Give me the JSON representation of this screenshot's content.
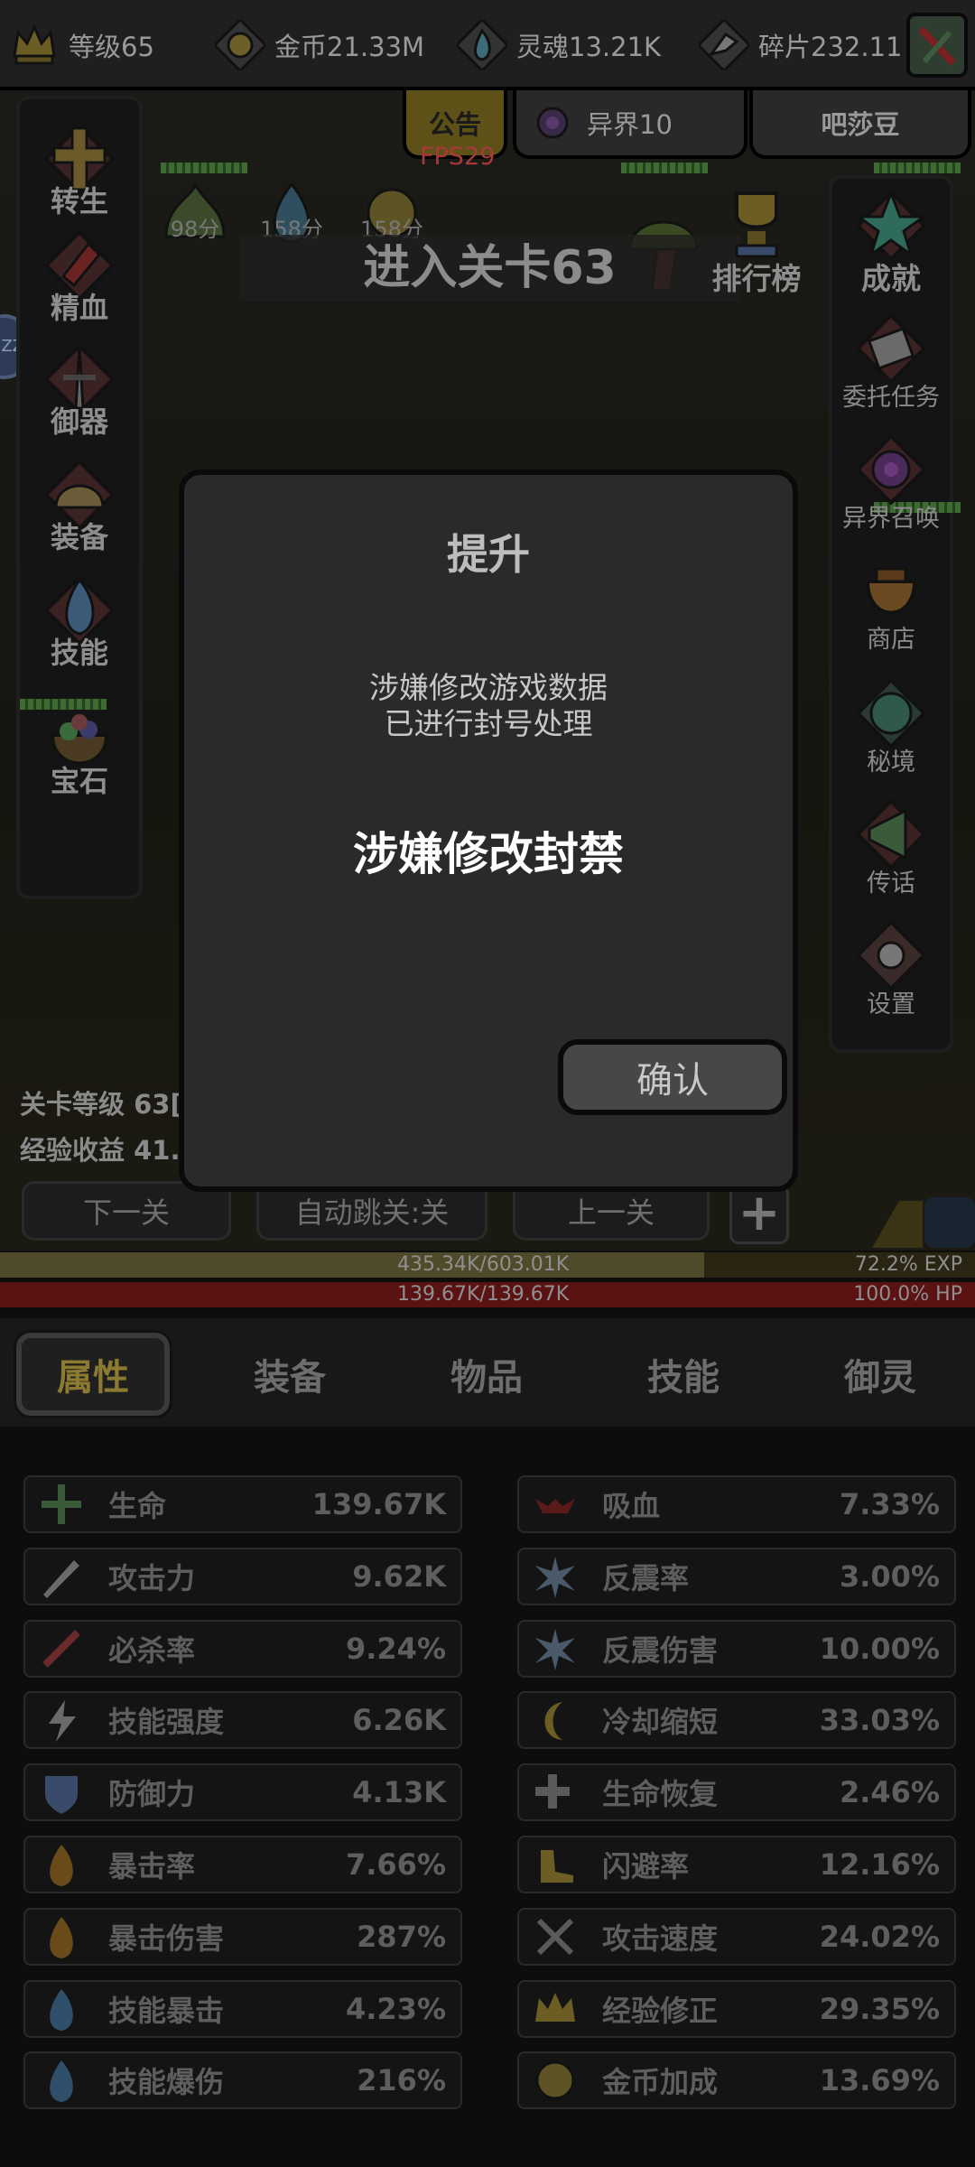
{
  "colors": {
    "accent_gold": "#8b7a30",
    "fps_red": "#a83a3a",
    "hp_red": "#5a1212",
    "exp_gold": "#4f4a2a"
  },
  "top_bar": {
    "resources": [
      {
        "icon": "crown-icon",
        "label": "等级65"
      },
      {
        "icon": "gold-coin-icon",
        "label": "金币21.33M"
      },
      {
        "icon": "soul-flame-icon",
        "label": "灵魂13.21K"
      },
      {
        "icon": "fragment-icon",
        "label": "碎片232.11"
      }
    ]
  },
  "header_tabs": {
    "notice": "公告",
    "otherworld": "异界10",
    "player": "吧莎豆"
  },
  "fps": "FPS29",
  "left_menu": [
    "转生",
    "精血",
    "御器",
    "装备",
    "技能",
    "宝石"
  ],
  "right_menu": [
    "排行榜",
    "成就",
    "委托任务",
    "异界召唤",
    "商店",
    "秘境",
    "传话",
    "设置"
  ],
  "monsters": [
    {
      "score": "98分"
    },
    {
      "score": "158分"
    },
    {
      "score": "158分"
    }
  ],
  "stage_banner": "进入关卡63",
  "stage_info": {
    "level": "关卡等级 63[",
    "exp_gain": "经验收益 41."
  },
  "nav": {
    "next": "下一关",
    "auto": "自动跳关:关",
    "prev": "上一关",
    "plus": "+"
  },
  "exp_bar": {
    "text": "435.34K/603.01K",
    "percent_text": "72.2% EXP",
    "fill": 0.722
  },
  "hp_bar": {
    "text": "139.67K/139.67K",
    "percent_text": "100.0%  HP",
    "fill": 1.0
  },
  "bottom_tabs": [
    "属性",
    "装备",
    "物品",
    "技能",
    "御灵"
  ],
  "stats_left": [
    {
      "icon": "health-cross-icon",
      "name": "生命",
      "value": "139.67K"
    },
    {
      "icon": "sword-icon",
      "name": "攻击力",
      "value": "9.62K"
    },
    {
      "icon": "crit-slash-icon",
      "name": "必杀率",
      "value": "9.24%"
    },
    {
      "icon": "lightning-icon",
      "name": "技能强度",
      "value": "6.26K"
    },
    {
      "icon": "shield-icon",
      "name": "防御力",
      "value": "4.13K"
    },
    {
      "icon": "fire-icon",
      "name": "暴击率",
      "value": "7.66%"
    },
    {
      "icon": "fire-icon",
      "name": "暴击伤害",
      "value": "287%"
    },
    {
      "icon": "blue-flame-icon",
      "name": "技能暴击",
      "value": "4.23%"
    },
    {
      "icon": "blue-flame-icon",
      "name": "技能爆伤",
      "value": "216%"
    }
  ],
  "stats_right": [
    {
      "icon": "bat-icon",
      "name": "吸血",
      "value": "7.33%"
    },
    {
      "icon": "burst-icon",
      "name": "反震率",
      "value": "3.00%"
    },
    {
      "icon": "burst-icon",
      "name": "反震伤害",
      "value": "10.00%"
    },
    {
      "icon": "cooldown-icon",
      "name": "冷却缩短",
      "value": "33.03%"
    },
    {
      "icon": "regen-cross-icon",
      "name": "生命恢复",
      "value": "2.46%"
    },
    {
      "icon": "boot-icon",
      "name": "闪避率",
      "value": "12.16%"
    },
    {
      "icon": "double-sword-icon",
      "name": "攻击速度",
      "value": "24.02%"
    },
    {
      "icon": "crown-icon",
      "name": "经验修正",
      "value": "29.35%"
    },
    {
      "icon": "gold-coin-icon",
      "name": "金币加成",
      "value": "13.69%"
    }
  ],
  "dialog": {
    "title": "提升",
    "message": "涉嫌修改游戏数据\n已进行封号处理",
    "status": "涉嫌修改封禁",
    "confirm": "确认"
  },
  "side_avatar": "ZZ"
}
